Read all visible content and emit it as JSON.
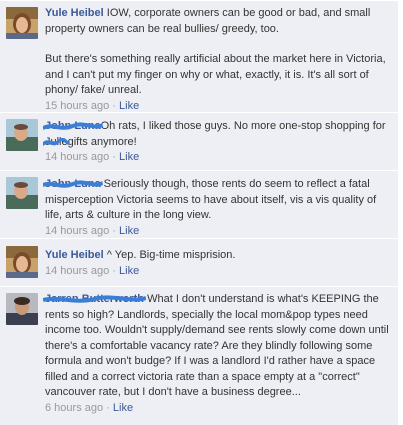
{
  "comments": [
    {
      "author": "Yule Heibel",
      "paragraphs": [
        "IOW, corporate owners can be good or bad, and small property owners can be real bullies/ greedy, too.",
        "But there's something really artificial about the market here in Victoria, and I can't put my finger on why or what, exactly, it is. It's all sort of phony/ fake/ unreal."
      ],
      "time": "15 hours ago",
      "separator": "·",
      "like": "Like"
    },
    {
      "author": "John Luna",
      "text_a": "Oh rats, I liked those guys. No more one-stop shopping for",
      "redacted_word": "Julie",
      "text_b": "gifts anymore!",
      "time": "14 hours ago",
      "separator": "·",
      "like": "Like"
    },
    {
      "author": "John Luna",
      "text": "Seriously though, those rents do seem to reflect a fatal misperception Victoria seems to have about itself, vis a vis quality of life, arts & culture in the long view.",
      "time": "14 hours ago",
      "separator": "·",
      "like": "Like"
    },
    {
      "author": "Yule Heibel",
      "text": "^ Yep. Big-time misprision.",
      "time": "14 hours ago",
      "separator": "·",
      "like": "Like"
    },
    {
      "author": "Jarren Butterworth",
      "text": "What I don't understand is what's KEEPING the rents so high? Landlords, specially the local mom&pop types need income too. Wouldn't supply/demand see rents slowly come down until there's a comfortable vacancy rate? Are they blindly following some formula and won't budge? If I was a landlord I'd rather have a space filled and a correct victoria rate than a space empty at a \"correct\" vancouver rate, but I don't have a business degree...",
      "time": "6 hours ago",
      "separator": "·",
      "like": "Like"
    }
  ],
  "colors": {
    "link": "#3b5998",
    "background": "#edeff4",
    "meta": "#999999",
    "scribble": "#3a7fd5"
  }
}
